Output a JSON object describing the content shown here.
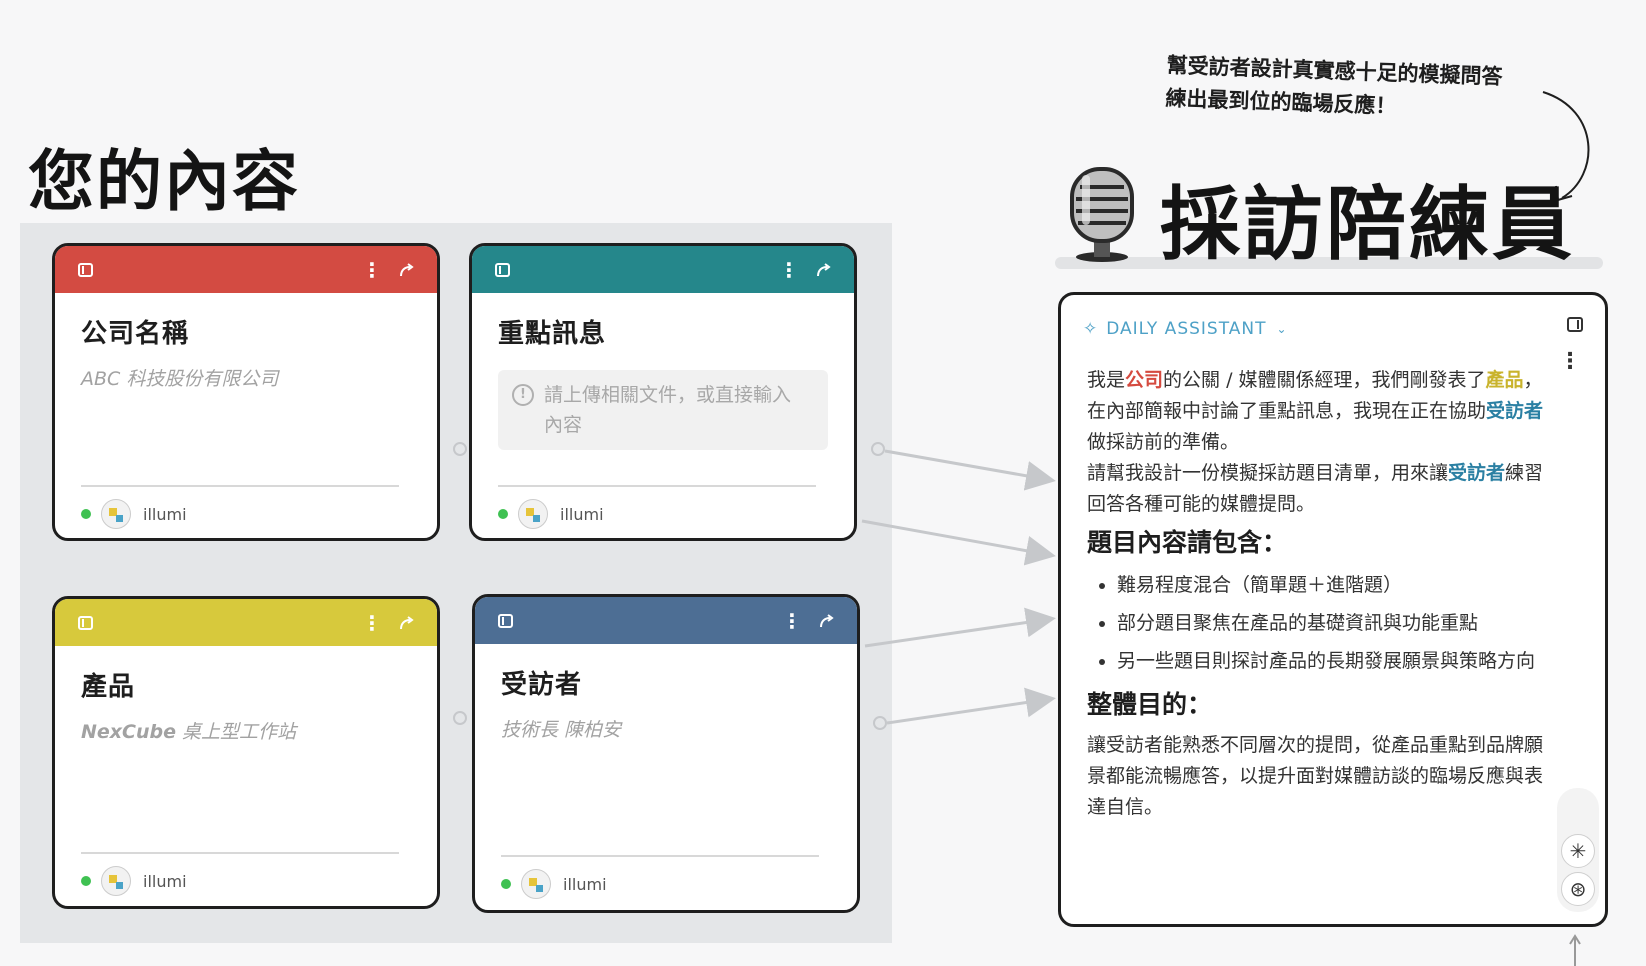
{
  "board": {
    "title": "您的內容",
    "cards": [
      {
        "title": "公司名稱",
        "placeholder": "ABC 科技股份有限公司",
        "owner": "illumi",
        "color": "#d34b42"
      },
      {
        "title": "重點訊息",
        "upload_hint_1": "請上傳相關文件，或直接輸入",
        "upload_hint_2": "內容",
        "owner": "illumi",
        "color": "#25878b"
      },
      {
        "title": "產品",
        "placeholder_brand": "NexCube",
        "placeholder_rest": " 桌上型工作站",
        "owner": "illumi",
        "color": "#d7c93c"
      },
      {
        "title": "受訪者",
        "placeholder": "技術長 陳柏安",
        "owner": "illumi",
        "color": "#4d6e94"
      }
    ]
  },
  "hero": {
    "tagline_1": "幫受訪者設計真實感十足的模擬問答",
    "tagline_2": "練出最到位的臨場反應！",
    "title": "採訪陪練員"
  },
  "assistant": {
    "label": "DAILY ASSISTANT",
    "p1": [
      "我是",
      "公司",
      "的公關 / 媒體關係經理，我們剛發表了",
      "產品",
      "，在內部簡報中討論了重點訊息，我現在正在協助",
      "受訪者",
      "做採訪前的準備。"
    ],
    "p2": [
      "請幫我設計一份模擬採訪題目清單，用來讓",
      "受訪者",
      "練習回答各種可能的媒體提問。"
    ],
    "h1": "題目內容請包含：",
    "bullets": [
      "難易程度混合（簡單題＋進階題）",
      "部分題目聚焦在產品的基礎資訊與功能重點",
      "另一些題目則探討產品的長期發展願景與策略方向"
    ],
    "h2": "整體目的：",
    "p3": "讓受訪者能熟悉不同層次的提問，從產品重點到品牌願景都能流暢應答，以提升面對媒體訪談的臨場反應與表達自信。"
  }
}
